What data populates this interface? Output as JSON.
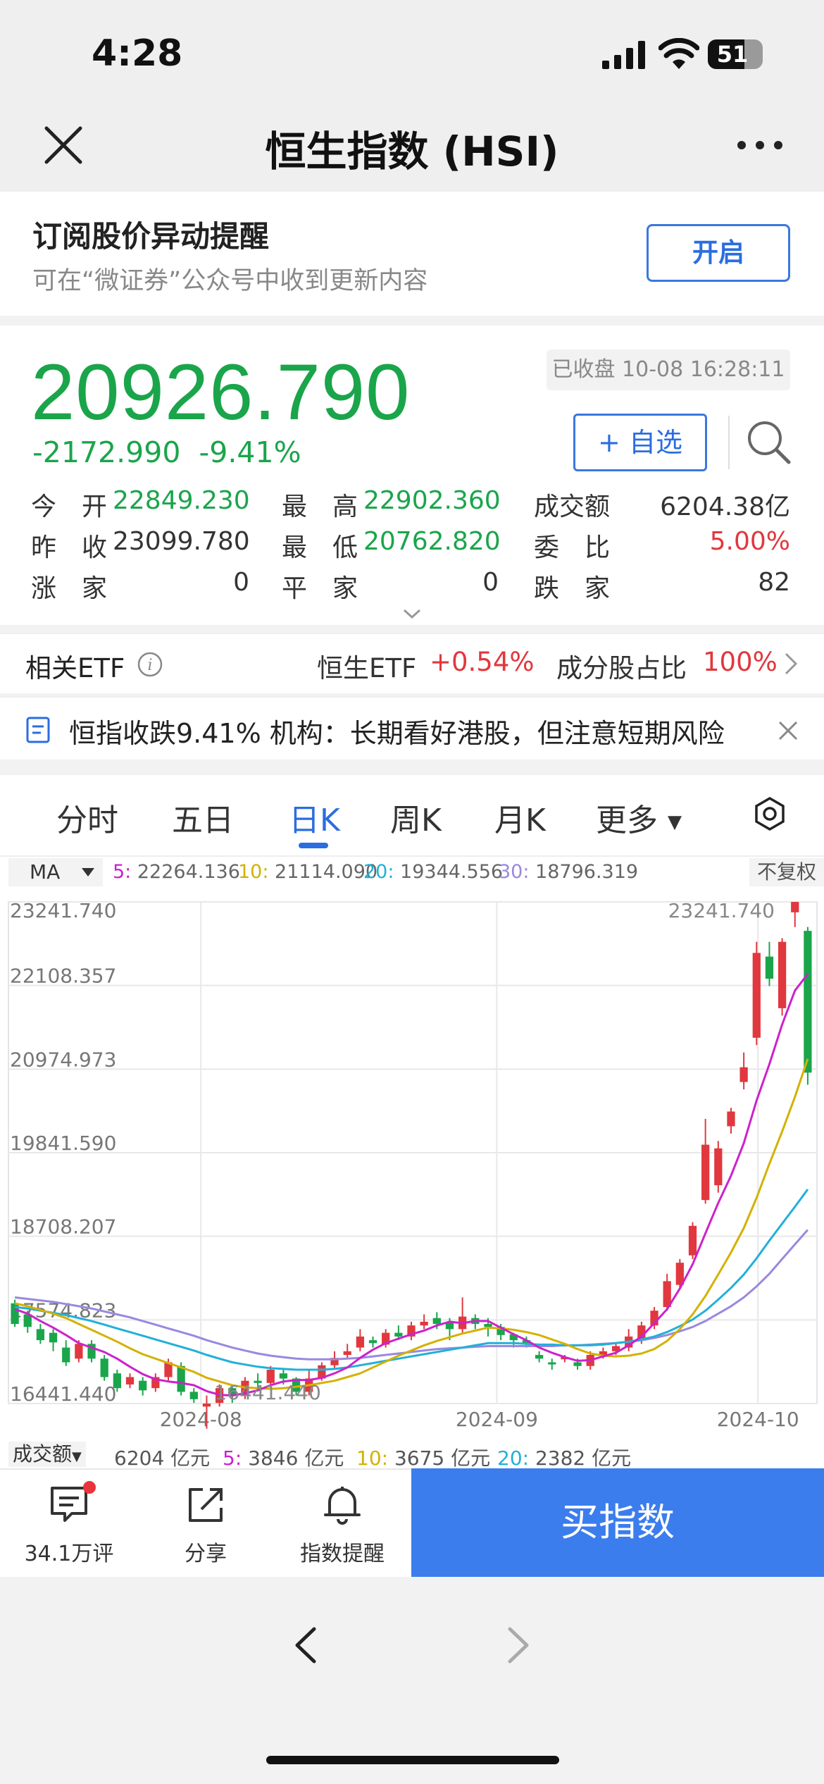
{
  "status_bar": {
    "time": "4:28",
    "battery": "51"
  },
  "nav": {
    "title": "恒生指数 (HSI)"
  },
  "subscribe": {
    "title": "订阅股价异动提醒",
    "desc": "可在“微证券”公众号中收到更新内容",
    "button": "开启"
  },
  "quote": {
    "price": "20926.790",
    "change": "-2172.990",
    "change_pct": "-9.41%",
    "status": "已收盘 10-08 16:28:11",
    "watch_button": "+ 自选",
    "stats": {
      "open_label": "今　开",
      "open": "22849.230",
      "high_label": "最　高",
      "high": "22902.360",
      "turnover_label": "成交额",
      "turnover": "6204.38亿",
      "prev_label": "昨　收",
      "prev": "23099.780",
      "low_label": "最　低",
      "low": "20762.820",
      "ratio_label": "委　比",
      "ratio": "5.00%",
      "up_label": "涨　家",
      "up": "0",
      "flat_label": "平　家",
      "flat": "0",
      "down_label": "跌　家",
      "down": "82"
    }
  },
  "etf": {
    "label": "相关ETF",
    "fund_name": "恒生ETF",
    "fund_change": "+0.54%",
    "weight_label": "成分股占比",
    "weight": "100%"
  },
  "news": {
    "text": "恒指收跌9.41% 机构：长期看好港股，但注意短期风险"
  },
  "tabs": [
    {
      "label": "分时"
    },
    {
      "label": "五日"
    },
    {
      "label": "日K"
    },
    {
      "label": "周K"
    },
    {
      "label": "月K"
    },
    {
      "label": "更多"
    }
  ],
  "ma": {
    "selector": "MA",
    "ma5_label": "5:",
    "ma5": "22264.136",
    "ma10_label": "10:",
    "ma10": "21114.090",
    "ma20_label": "20:",
    "ma20": "19344.556",
    "ma30_label": "30:",
    "ma30": "18796.319",
    "adjust": "不复权"
  },
  "colors": {
    "up": "#e0383e",
    "down": "#1aa54b",
    "ma5": "#cc22cc",
    "ma10": "#d4b100",
    "ma20": "#22b0d8",
    "ma30": "#9a88e0",
    "accent": "#2b6de0"
  },
  "chart_data": {
    "type": "candlestick",
    "y_ticks": [
      "23241.740",
      "22108.357",
      "20974.973",
      "19841.590",
      "18708.207",
      "17574.823",
      "16441.440"
    ],
    "ylim": [
      16441.44,
      23241.74
    ],
    "x_ticks": [
      "2024-08",
      "2024-09",
      "2024-10"
    ],
    "max_label": "23241.740",
    "min_label": "16441.440",
    "candles": [
      [
        17800,
        17520,
        17850,
        17480
      ],
      [
        17650,
        17480,
        17700,
        17400
      ],
      [
        17450,
        17300,
        17520,
        17250
      ],
      [
        17400,
        17270,
        17450,
        17150
      ],
      [
        17200,
        17000,
        17300,
        16950
      ],
      [
        17050,
        17250,
        17300,
        17000
      ],
      [
        17250,
        17050,
        17300,
        17000
      ],
      [
        17050,
        16800,
        17100,
        16750
      ],
      [
        16850,
        16650,
        16900,
        16600
      ],
      [
        16700,
        16800,
        16850,
        16650
      ],
      [
        16750,
        16620,
        16800,
        16550
      ],
      [
        16650,
        16800,
        16850,
        16600
      ],
      [
        16800,
        17000,
        17050,
        16750
      ],
      [
        16950,
        16600,
        17000,
        16550
      ],
      [
        16600,
        16500,
        16650,
        16450
      ],
      [
        16400,
        16441,
        16550,
        16100
      ],
      [
        16450,
        16650,
        16700,
        16400
      ],
      [
        16650,
        16550,
        16700,
        16450
      ],
      [
        16560,
        16750,
        16800,
        16500
      ],
      [
        16750,
        16720,
        16850,
        16650
      ],
      [
        16720,
        16900,
        16950,
        16650
      ],
      [
        16850,
        16780,
        16900,
        16700
      ],
      [
        16780,
        16600,
        16800,
        16550
      ],
      [
        16600,
        16780,
        16900,
        16550
      ],
      [
        16780,
        16960,
        17000,
        16750
      ],
      [
        16960,
        17060,
        17150,
        16900
      ],
      [
        17100,
        17150,
        17250,
        17050
      ],
      [
        17200,
        17350,
        17450,
        17150
      ],
      [
        17300,
        17260,
        17350,
        17200
      ],
      [
        17240,
        17400,
        17450,
        17200
      ],
      [
        17400,
        17350,
        17500,
        17300
      ],
      [
        17350,
        17500,
        17550,
        17300
      ],
      [
        17500,
        17550,
        17650,
        17450
      ],
      [
        17600,
        17520,
        17680,
        17450
      ],
      [
        17550,
        17450,
        17600,
        17300
      ],
      [
        17450,
        17620,
        17880,
        17400
      ],
      [
        17600,
        17520,
        17650,
        17450
      ],
      [
        17520,
        17480,
        17600,
        17350
      ],
      [
        17480,
        17370,
        17520,
        17300
      ],
      [
        17380,
        17300,
        17400,
        17200
      ],
      [
        17300,
        17240,
        17350,
        17200
      ],
      [
        17100,
        17050,
        17150,
        17000
      ],
      [
        17000,
        16980,
        17050,
        16900
      ],
      [
        17050,
        17070,
        17100,
        17000
      ],
      [
        17000,
        16950,
        17050,
        16900
      ],
      [
        16950,
        17100,
        17150,
        16900
      ],
      [
        17100,
        17150,
        17200,
        17050
      ],
      [
        17150,
        17220,
        17250,
        17100
      ],
      [
        17200,
        17350,
        17450,
        17150
      ],
      [
        17300,
        17500,
        17550,
        17250
      ],
      [
        17500,
        17700,
        17750,
        17450
      ],
      [
        17750,
        18100,
        18200,
        17700
      ],
      [
        18050,
        18350,
        18400,
        18000
      ],
      [
        18450,
        18850,
        18900,
        18400
      ],
      [
        19200,
        19950,
        20300,
        19150
      ],
      [
        19400,
        19900,
        20000,
        19300
      ],
      [
        20200,
        20400,
        20450,
        20100
      ],
      [
        20800,
        21000,
        21200,
        20700
      ],
      [
        21400,
        22550,
        22700,
        21300
      ],
      [
        22500,
        22200,
        22700,
        22100
      ],
      [
        21800,
        22700,
        22750,
        21700
      ],
      [
        23100,
        23241,
        23241,
        22900
      ],
      [
        22849,
        20927,
        22902,
        20763
      ]
    ],
    "ma5": [
      17720,
      17660,
      17560,
      17470,
      17370,
      17260,
      17200,
      17140,
      17050,
      16940,
      16840,
      16770,
      16740,
      16720,
      16690,
      16610,
      16560,
      16550,
      16580,
      16620,
      16690,
      16740,
      16760,
      16760,
      16790,
      16850,
      16930,
      17060,
      17170,
      17260,
      17320,
      17380,
      17430,
      17500,
      17550,
      17530,
      17560,
      17560,
      17470,
      17380,
      17300,
      17200,
      17130,
      17070,
      17020,
      17030,
      17080,
      17130,
      17230,
      17350,
      17530,
      17720,
      18000,
      18330,
      18750,
      19160,
      19530,
      19970,
      20550,
      21040,
      21580,
      22040,
      22264
    ],
    "ma10": [
      17800,
      17760,
      17710,
      17660,
      17600,
      17520,
      17440,
      17360,
      17280,
      17190,
      17110,
      17050,
      16990,
      16930,
      16870,
      16790,
      16740,
      16690,
      16660,
      16650,
      16640,
      16650,
      16670,
      16690,
      16720,
      16750,
      16800,
      16850,
      16930,
      17010,
      17090,
      17160,
      17230,
      17290,
      17340,
      17390,
      17430,
      17470,
      17460,
      17440,
      17410,
      17370,
      17310,
      17250,
      17180,
      17120,
      17090,
      17080,
      17090,
      17120,
      17180,
      17290,
      17450,
      17650,
      17900,
      18190,
      18490,
      18820,
      19230,
      19690,
      20130,
      20600,
      21114
    ],
    "ma20": [
      17750,
      17730,
      17700,
      17670,
      17640,
      17600,
      17560,
      17510,
      17460,
      17410,
      17360,
      17310,
      17260,
      17210,
      17160,
      17100,
      17050,
      17000,
      16970,
      16940,
      16920,
      16910,
      16900,
      16900,
      16900,
      16910,
      16930,
      16960,
      16990,
      17020,
      17050,
      17080,
      17110,
      17140,
      17170,
      17200,
      17230,
      17260,
      17260,
      17260,
      17250,
      17240,
      17240,
      17230,
      17230,
      17230,
      17240,
      17260,
      17280,
      17310,
      17350,
      17410,
      17490,
      17580,
      17700,
      17850,
      18010,
      18190,
      18410,
      18650,
      18880,
      19110,
      19345
    ],
    "ma30": [
      17880,
      17860,
      17840,
      17820,
      17790,
      17760,
      17730,
      17690,
      17650,
      17610,
      17560,
      17510,
      17460,
      17410,
      17360,
      17300,
      17250,
      17200,
      17160,
      17120,
      17090,
      17070,
      17050,
      17040,
      17040,
      17040,
      17050,
      17060,
      17080,
      17100,
      17120,
      17140,
      17160,
      17180,
      17190,
      17200,
      17210,
      17220,
      17220,
      17220,
      17220,
      17220,
      17220,
      17230,
      17230,
      17240,
      17250,
      17260,
      17280,
      17300,
      17330,
      17370,
      17420,
      17480,
      17560,
      17660,
      17760,
      17880,
      18030,
      18200,
      18400,
      18600,
      18796
    ]
  },
  "volume": {
    "selector": "成交额",
    "current": "6204 亿元",
    "v5_label": "5:",
    "v5": "3846 亿元",
    "v10_label": "10:",
    "v10": "3675 亿元",
    "v20_label": "20:",
    "v20": "2382 亿元"
  },
  "bottom": {
    "comments": "34.1万评",
    "share": "分享",
    "alert": "指数提醒",
    "buy": "买指数"
  }
}
